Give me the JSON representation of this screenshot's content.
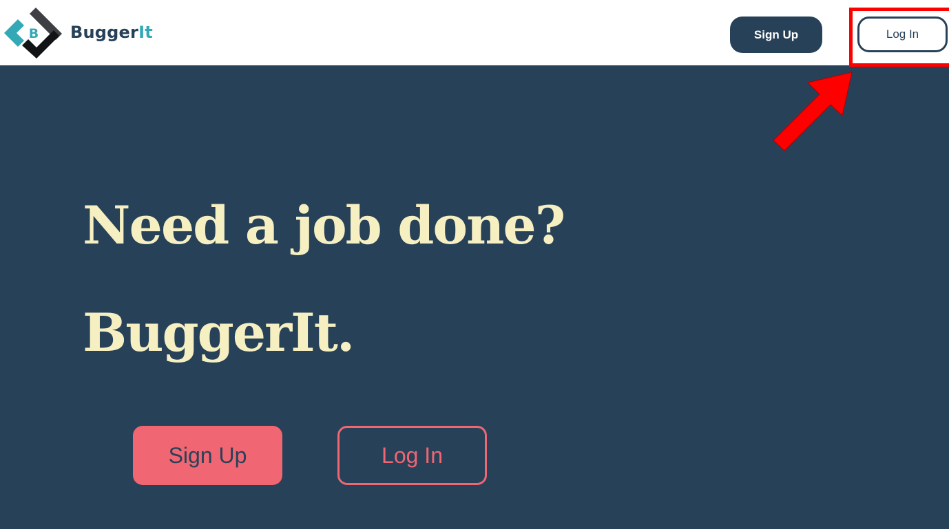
{
  "header": {
    "brand_main": "Bugger",
    "brand_accent": "It",
    "logo_letter": "B",
    "signup_label": "Sign Up",
    "login_label": "Log In"
  },
  "hero": {
    "headline": "Need a job done?",
    "brand_line": "BuggerIt.",
    "signup_label": "Sign Up",
    "login_label": "Log In"
  },
  "annotation": {
    "highlight_color": "#ff0000",
    "target": "Log In"
  },
  "colors": {
    "navy": "#274158",
    "teal": "#33a9b5",
    "cream": "#f6efc2",
    "coral": "#f06672",
    "white": "#ffffff"
  }
}
